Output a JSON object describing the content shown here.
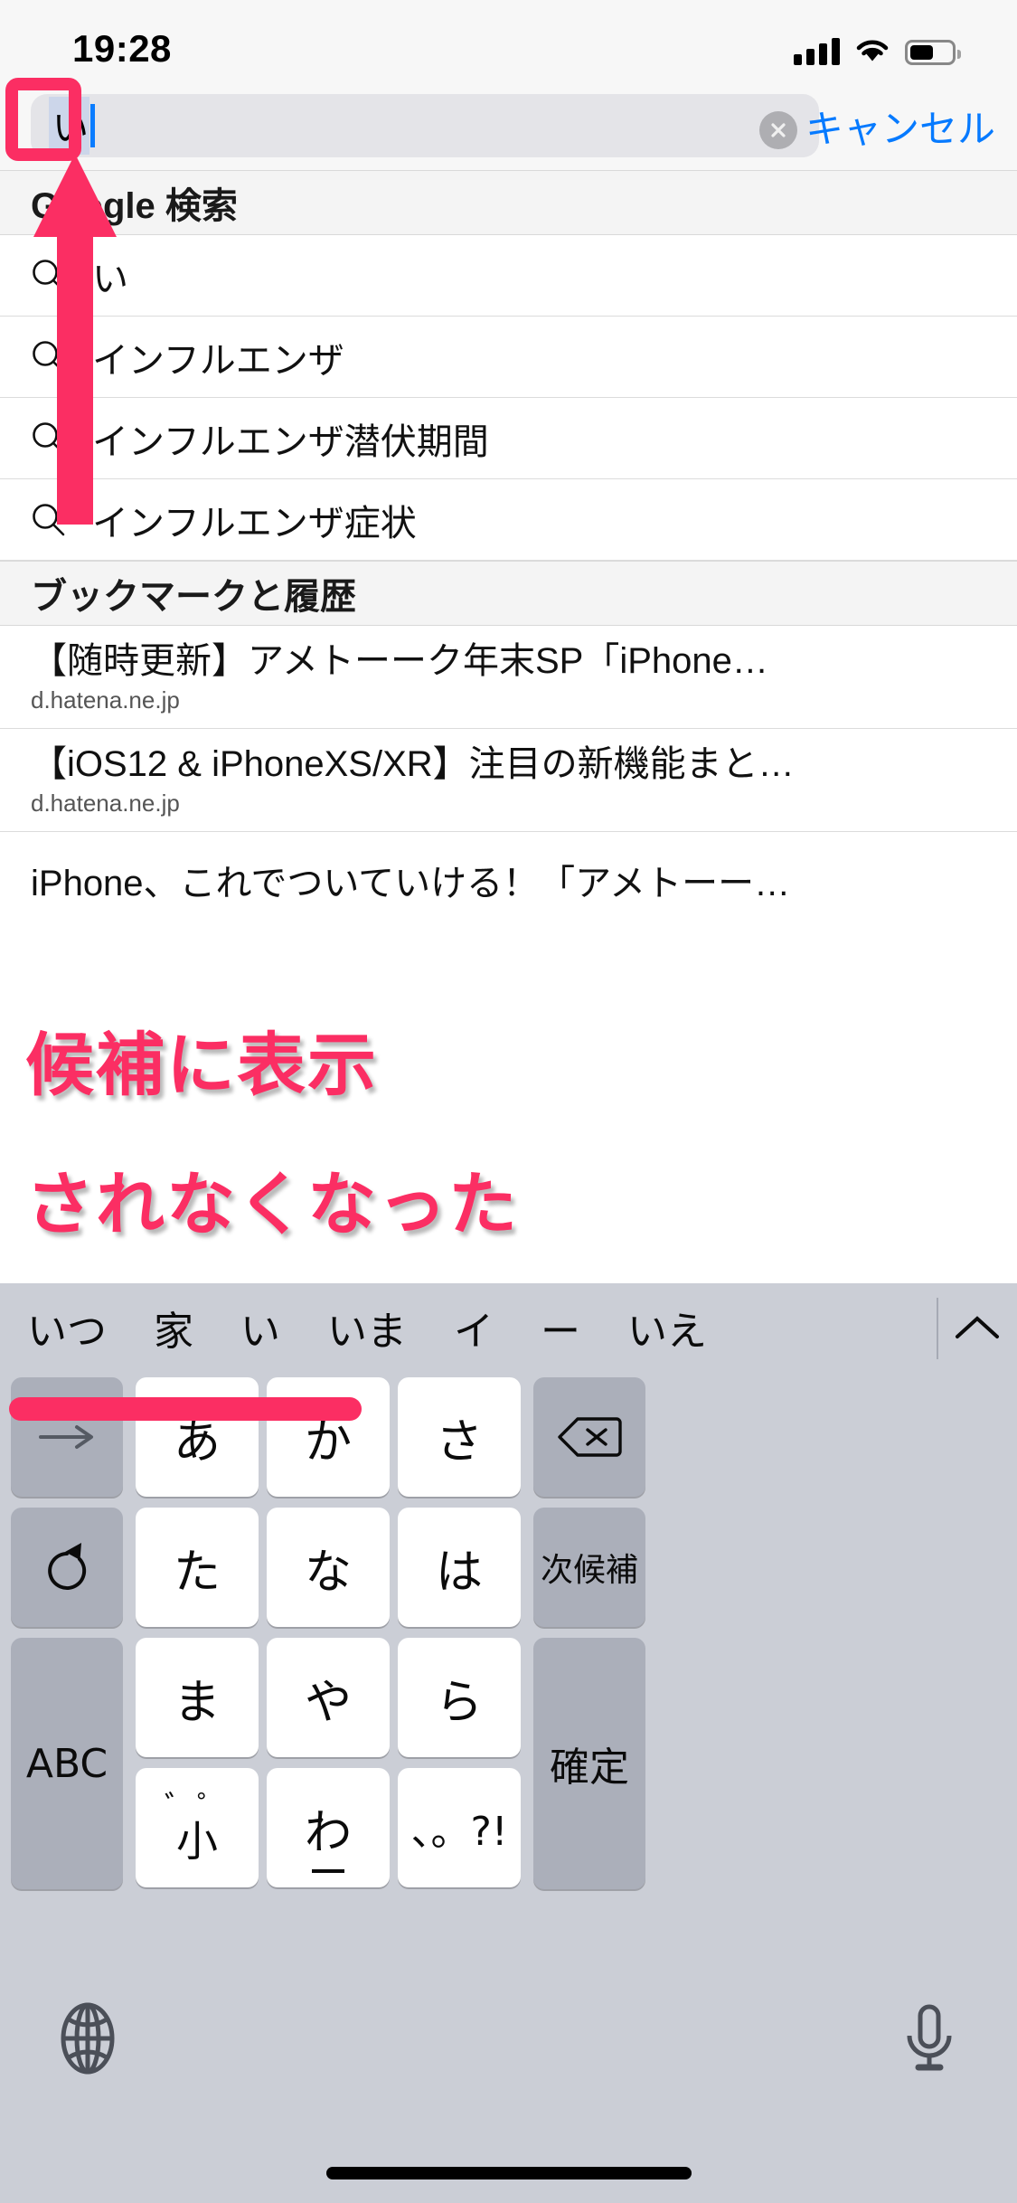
{
  "status_bar": {
    "time": "19:28",
    "signal_icon": "cellular-signal-icon",
    "wifi_icon": "wifi-icon",
    "battery_icon": "battery-icon"
  },
  "search_bar": {
    "composing_text": "い",
    "clear_icon": "clear-circle-icon",
    "cancel_label": "キャンセル"
  },
  "results": {
    "sections": [
      {
        "header": "Google 検索",
        "type": "suggestions",
        "items": [
          {
            "icon": "search-icon",
            "text": "い"
          },
          {
            "icon": "search-icon",
            "text": "インフルエンザ"
          },
          {
            "icon": "search-icon",
            "text": "インフルエンザ潜伏期間"
          },
          {
            "icon": "search-icon",
            "text": "インフルエンザ症状"
          }
        ]
      },
      {
        "header": "ブックマークと履歴",
        "type": "bookmarks",
        "items": [
          {
            "title": "【随時更新】アメトーーク年末SP「iPhone…",
            "url": "d.hatena.ne.jp"
          },
          {
            "title": "【iOS12 & iPhoneXS/XR】注目の新機能まと…",
            "url": "d.hatena.ne.jp"
          },
          {
            "title": "iPhone、これでついていける！「アメトーー…",
            "url": ""
          }
        ]
      }
    ]
  },
  "keyboard": {
    "candidates": [
      "いつ",
      "家",
      "い",
      "いま",
      "イ",
      "ー",
      "いえ"
    ],
    "expand_icon": "chevron-up-icon",
    "rows": [
      [
        {
          "name": "cursor-right-key",
          "label": "→",
          "style": "dark",
          "icon": "arrow-right-icon"
        },
        {
          "name": "key-a",
          "label": "あ",
          "style": "light"
        },
        {
          "name": "key-ka",
          "label": "か",
          "style": "light"
        },
        {
          "name": "key-sa",
          "label": "さ",
          "style": "light"
        },
        {
          "name": "delete-key",
          "label": "⌫",
          "style": "dark",
          "icon": "delete-backward-icon"
        }
      ],
      [
        {
          "name": "undo-key",
          "label": "↺",
          "style": "dark",
          "icon": "undo-icon"
        },
        {
          "name": "key-ta",
          "label": "た",
          "style": "light"
        },
        {
          "name": "key-na",
          "label": "な",
          "style": "light"
        },
        {
          "name": "key-ha",
          "label": "は",
          "style": "light"
        },
        {
          "name": "next-candidate-key",
          "label": "次候補",
          "style": "dark"
        }
      ],
      [
        {
          "name": "abc-key",
          "label": "ABC",
          "style": "dark"
        },
        {
          "name": "key-ma",
          "label": "ま",
          "style": "light"
        },
        {
          "name": "key-ya",
          "label": "や",
          "style": "light"
        },
        {
          "name": "key-ra",
          "label": "ら",
          "style": "light"
        },
        {
          "name": "confirm-key",
          "label": "確定",
          "style": "dark"
        }
      ],
      [
        {
          "name": "key-small-dakuten",
          "label": "小゛゜",
          "style": "light",
          "top": "゛゜",
          "bottom": "小"
        },
        {
          "name": "key-wa",
          "label": "わ",
          "style": "light"
        },
        {
          "name": "key-punctuation",
          "label": "、。?!",
          "style": "light"
        }
      ]
    ],
    "globe_icon": "globe-icon",
    "mic_icon": "microphone-icon",
    "home_indicator": "home-indicator"
  },
  "annotations": {
    "accent_color": "#fb2e63",
    "highlight_box": "composing-field-highlight",
    "arrow": "upward-arrow",
    "underline": "candidate-bar-underline",
    "line1": "候補に表示",
    "line2": "されなくなった"
  }
}
